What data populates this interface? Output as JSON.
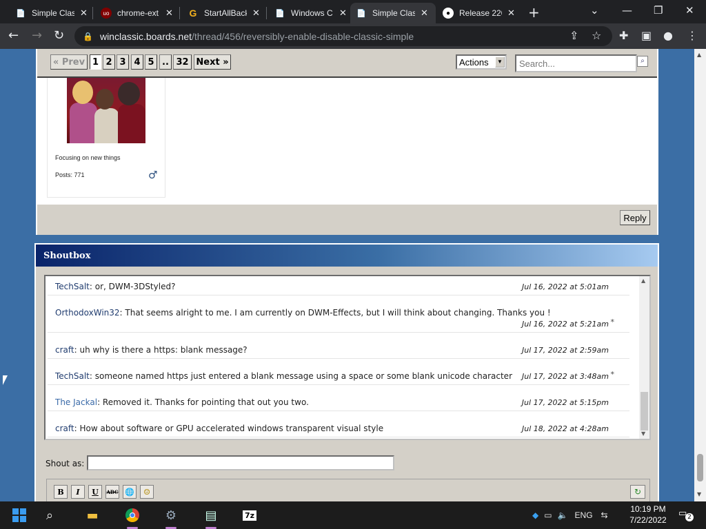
{
  "browser": {
    "tabs": [
      {
        "title": "Simple Clas",
        "icon": "page-icon",
        "active": false
      },
      {
        "title": "chrome-ext",
        "icon": "ublock-icon",
        "active": false
      },
      {
        "title": "StartAllBack",
        "icon": "google-icon",
        "active": false
      },
      {
        "title": "Windows C",
        "icon": "page-icon",
        "active": false
      },
      {
        "title": "Simple Clas",
        "icon": "page-icon",
        "active": true
      },
      {
        "title": "Release 220",
        "icon": "github-icon",
        "active": false
      }
    ],
    "url_host": "winclassic.boards.net",
    "url_path": "/thread/456/reversibly-enable-disable-classic-simple"
  },
  "pager": {
    "prev_label": "« Prev",
    "pages": [
      "1",
      "2",
      "3",
      "4",
      "5",
      "..",
      "32"
    ],
    "current_page": "1",
    "next_label": "Next »",
    "actions_value": "Actions",
    "search_placeholder": "Search..."
  },
  "post": {
    "status_text": "Focusing on new things",
    "posts_text": "Posts: 771",
    "gender_symbol": "♂",
    "reply_label": "Reply"
  },
  "shoutbox": {
    "title": "Shoutbox",
    "shouts": [
      {
        "user": "TechSalt",
        "text": ": or, DWM-3DStyled?",
        "time": "Jul 16, 2022 at 5:01am",
        "edited": false
      },
      {
        "user": "OrthodoxWin32",
        "text": ": That seems alright to me. I am currently on DWM-Effects, but I will think about changing. Thanks you !",
        "time": "Jul 16, 2022 at 5:21am",
        "edited": true
      },
      {
        "user": "craft",
        "text": ": uh why is there a https: blank message?",
        "time": "Jul 17, 2022 at 2:59am",
        "edited": false
      },
      {
        "user": "TechSalt",
        "text": ": someone named https just entered a blank message using a space or some blank unicode character",
        "time": "Jul 17, 2022 at 3:48am",
        "edited": true
      },
      {
        "user": "The Jackal",
        "text": ": Removed it. Thanks for pointing that out you two.",
        "time": "Jul 17, 2022 at 5:15pm",
        "edited": false
      },
      {
        "user": "craft",
        "text": ": How about software or GPU accelerated windows transparent visual style",
        "time": "Jul 18, 2022 at 4:28am",
        "edited": false
      }
    ],
    "edited_mark": "*",
    "shout_as_label": "Shout as:",
    "editor_buttons": [
      {
        "name": "bold-button",
        "label": "B"
      },
      {
        "name": "italic-button",
        "label": "I"
      },
      {
        "name": "underline-button",
        "label": "U"
      },
      {
        "name": "strikethrough-button",
        "label": "ABC"
      },
      {
        "name": "link-button",
        "label": "🌐"
      },
      {
        "name": "emoji-button",
        "label": "☺"
      }
    ]
  },
  "taskbar": {
    "language": "ENG",
    "time": "10:19 PM",
    "date": "7/22/2022",
    "notification_count": "2"
  }
}
